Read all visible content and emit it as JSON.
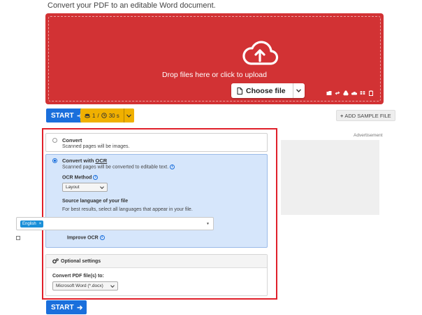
{
  "page": {
    "subtitle": "Convert your PDF to an editable Word document."
  },
  "dropzone": {
    "text": "Drop files here or click to upload",
    "choose_label": "Choose file",
    "background": "#d23234",
    "source_icons": [
      "folder-icon",
      "link-icon",
      "google-drive-icon",
      "onedrive-icon",
      "dropbox-icon",
      "clipboard-icon"
    ]
  },
  "actions": {
    "start_label": "START",
    "limit_count": "1",
    "limit_separator": "/",
    "limit_time": "30 s",
    "add_sample_label": "ADD SAMPLE FILE",
    "accent": "#1a6fdc",
    "limit_color": "#f0b000"
  },
  "ad": {
    "label": "Advertisement"
  },
  "options": {
    "convert": {
      "title": "Convert",
      "subtitle": "Scanned pages will be images.",
      "selected": false
    },
    "ocr": {
      "title_prefix": "Convert with ",
      "title_ocr": "OCR",
      "subtitle": "Scanned pages will be converted to editable text.",
      "selected": true,
      "method_label": "OCR Method",
      "method_value": "Layout",
      "language_label": "Source language of your file",
      "language_hint": "For best results, select all languages that appear in your file.",
      "languages": [
        "English"
      ],
      "improve_label": "Improve OCR",
      "improve_checked": false
    }
  },
  "optional_settings": {
    "header": "Optional settings",
    "convert_to_label": "Convert PDF file(s) to:",
    "convert_to_value": "Microsoft Word (*.docx)"
  },
  "highlight_color": "#e0202a"
}
